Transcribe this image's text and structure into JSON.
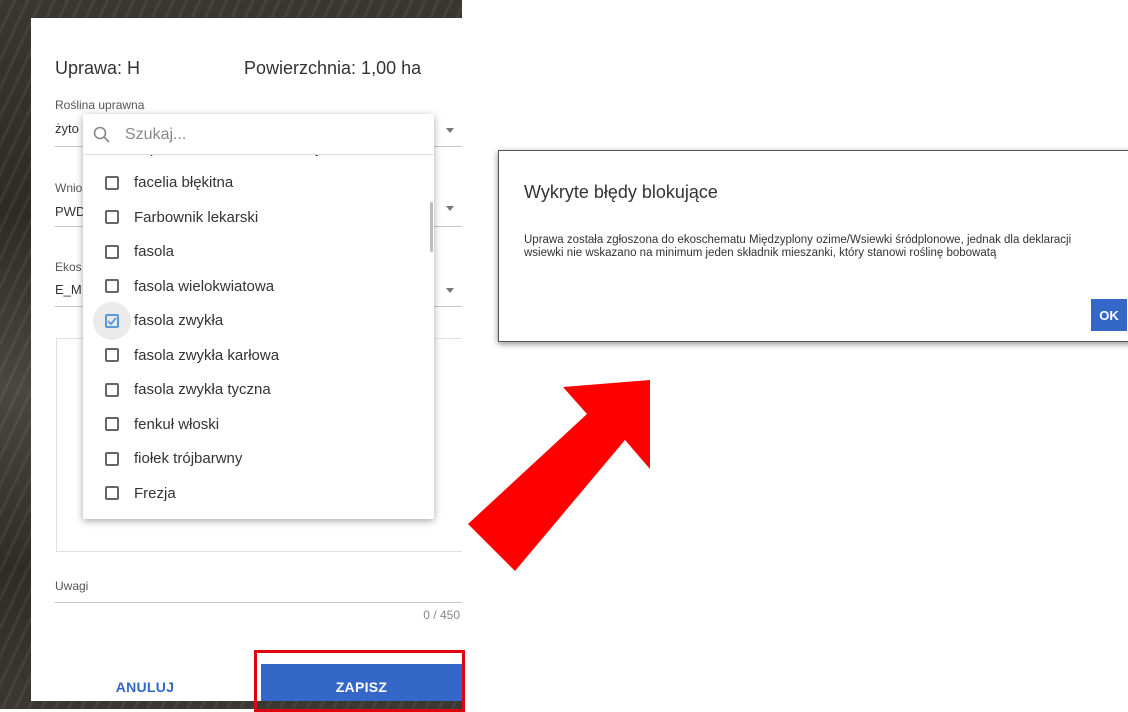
{
  "form": {
    "title_uprawa": "Uprawa: H",
    "title_powierzchnia": "Powierzchnia: 1,00 ha",
    "field1": {
      "label": "Roślina uprawna",
      "value": "żyto"
    },
    "field2": {
      "label": "Wnio",
      "value": "PWD"
    },
    "field3": {
      "label": "Ekos",
      "value": "E_M"
    },
    "uwagi": {
      "label": "Uwagi",
      "counter": "0 / 450"
    },
    "cancel_label": "ANULUJ",
    "save_label": "ZAPISZ",
    "save_highlight_color": "#e0000f",
    "save_button_color": "#3467c7"
  },
  "dropdown": {
    "search_placeholder": "Szukaj...",
    "options": [
      {
        "label": "esparceta siewna na zielony nawóz w rolce",
        "checked": false
      },
      {
        "label": "facelia błękitna",
        "checked": false
      },
      {
        "label": "Farbownik lekarski",
        "checked": false
      },
      {
        "label": "fasola",
        "checked": false
      },
      {
        "label": "fasola wielokwiatowa",
        "checked": false
      },
      {
        "label": "fasola zwykła",
        "checked": true
      },
      {
        "label": "fasola zwykła karłowa",
        "checked": false
      },
      {
        "label": "fasola zwykła tyczna",
        "checked": false
      },
      {
        "label": "fenkuł włoski",
        "checked": false
      },
      {
        "label": "fiołek trójbarwny",
        "checked": false
      },
      {
        "label": "Frezja",
        "checked": false
      }
    ]
  },
  "error_modal": {
    "title": "Wykryte błędy blokujące",
    "message": "Uprawa została zgłoszona do ekoschematu Międzyplony ozime/Wsiewki śródplonowe, jednak dla deklaracji wsiewki nie wskazano na minimum jeden składnik mieszanki, który stanowi roślinę bobowatą",
    "ok_label": "OK",
    "ok_color": "#3467c7"
  },
  "annotation": {
    "arrow_color": "#ff0000"
  }
}
